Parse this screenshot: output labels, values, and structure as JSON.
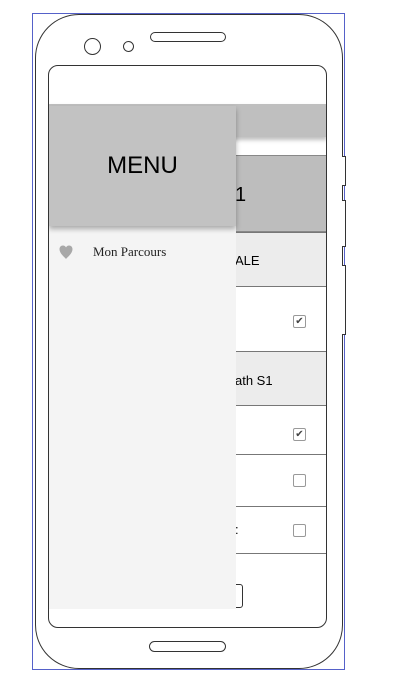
{
  "drawer": {
    "title": "MENU",
    "items": [
      {
        "label": "Mon Parcours",
        "icon": "heart-icon"
      }
    ]
  },
  "screen": {
    "title_visible": "1",
    "sections": [
      {
        "label_visible": "ALE"
      },
      {
        "label_visible": "ath S1"
      }
    ],
    "rows": [
      {
        "label_visible": "",
        "checked": true
      },
      {
        "label_visible": "",
        "checked": true
      },
      {
        "label_visible": "",
        "checked": false
      },
      {
        "label_visible": ":",
        "checked": false
      }
    ],
    "check_glyph": "✔"
  },
  "colors": {
    "frame_outline": "#5561c9",
    "drawer_header": "#c2c2c2",
    "drawer_body": "#f4f4f4",
    "topbar": "#bfbfbf",
    "section_bg": "#ececec"
  }
}
